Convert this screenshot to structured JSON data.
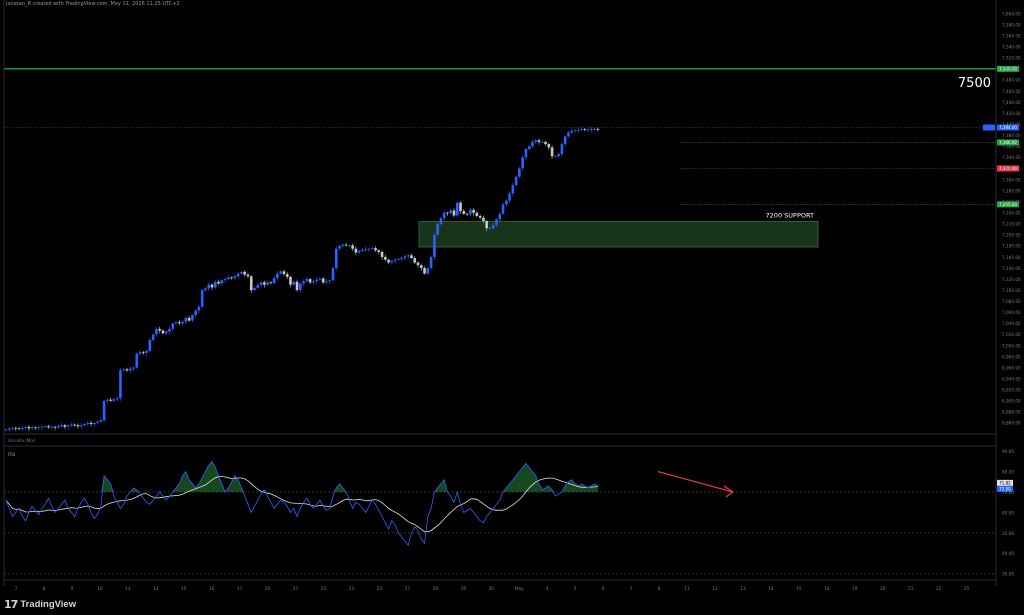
{
  "header": {
    "attribution": "Jonatan_R created with TradingView.com, May 11, 2026 11:25 UTC+2"
  },
  "footer": {
    "brand": "TradingView"
  },
  "colors": {
    "up": "#2962ff",
    "down": "#c7c7c7",
    "resistance": "#26a641",
    "support_fill": "#1b3a1e",
    "support_stroke": "#3f7a3f",
    "rsi_line": "#2962ff",
    "rsi_ma": "#e0e0e0",
    "arrow": "#f23645"
  },
  "chart_data": [
    {
      "type": "candlestick",
      "x_labels": [
        "7",
        "8",
        "9",
        "10",
        "13",
        "14",
        "15",
        "16",
        "17",
        "20",
        "21",
        "22",
        "23",
        "24",
        "27",
        "28",
        "29",
        "30",
        "May",
        "4",
        "5",
        "6",
        "7",
        "8",
        "11",
        "12",
        "13",
        "14",
        "15",
        "18",
        "19",
        "20",
        "21",
        "22",
        "25"
      ],
      "y_ticks": [
        "7,600.00",
        "7,580.00",
        "7,560.00",
        "7,540.00",
        "7,520.00",
        "7,500.00",
        "7,480.00",
        "7,460.00",
        "7,440.00",
        "7,420.00",
        "7,400.00",
        "7,380.00",
        "7,360.00",
        "7,340.00",
        "7,320.00",
        "7,300.00",
        "7,280.00",
        "7,260.00",
        "7,240.00",
        "7,220.00",
        "7,200.00",
        "7,180.00",
        "7,160.00",
        "7,140.00",
        "7,120.00",
        "7,100.00",
        "7,080.00",
        "7,060.00",
        "7,040.00",
        "7,020.00",
        "7,000.00",
        "6,980.00",
        "6,960.00",
        "6,940.00",
        "6,920.00",
        "6,900.00",
        "6,880.00",
        "6,860.00",
        "6,840.00"
      ],
      "ylim": [
        6840,
        7610
      ],
      "closes": [
        6848,
        6850,
        6851,
        6850,
        6849,
        6851,
        6853,
        6850,
        6852,
        6851,
        6852,
        6853,
        6854,
        6852,
        6853,
        6852,
        6854,
        6856,
        6853,
        6855,
        6857,
        6856,
        6854,
        6856,
        6858,
        6860,
        6858,
        6860,
        6862,
        6865,
        6900,
        6902,
        6900,
        6903,
        6905,
        6955,
        6957,
        6955,
        6958,
        6960,
        6985,
        6988,
        6987,
        6990,
        7010,
        7020,
        7030,
        7027,
        7022,
        7025,
        7030,
        7040,
        7042,
        7040,
        7043,
        7050,
        7045,
        7055,
        7063,
        7070,
        7100,
        7103,
        7110,
        7105,
        7115,
        7112,
        7118,
        7120,
        7123,
        7122,
        7125,
        7130,
        7133,
        7128,
        7125,
        7100,
        7104,
        7109,
        7114,
        7110,
        7114,
        7113,
        7122,
        7130,
        7134,
        7129,
        7124,
        7110,
        7115,
        7100,
        7112,
        7116,
        7120,
        7114,
        7116,
        7119,
        7121,
        7114,
        7116,
        7118,
        7140,
        7175,
        7180,
        7182,
        7181,
        7181,
        7175,
        7168,
        7171,
        7173,
        7174,
        7175,
        7176,
        7172,
        7169,
        7160,
        7155,
        7150,
        7153,
        7155,
        7156,
        7158,
        7161,
        7163,
        7158,
        7150,
        7145,
        7140,
        7130,
        7140,
        7160,
        7200,
        7220,
        7230,
        7240,
        7239,
        7244,
        7235,
        7258,
        7243,
        7238,
        7237,
        7245,
        7240,
        7234,
        7231,
        7225,
        7212,
        7212,
        7218,
        7228,
        7238,
        7255,
        7262,
        7275,
        7290,
        7305,
        7320,
        7340,
        7355,
        7360,
        7368,
        7371,
        7368,
        7368,
        7364,
        7358,
        7342,
        7342,
        7346,
        7364,
        7378,
        7385,
        7388,
        7389,
        7390,
        7391,
        7390,
        7390,
        7391,
        7391,
        7390
      ],
      "ohlc_units": "index points",
      "current_price_label": "7,394.00",
      "price_tags": [
        {
          "text": "7,500.00",
          "price": 7500,
          "color": "#26a641"
        },
        {
          "text": "7,394.00",
          "price": 7394,
          "color": "#2962ff"
        },
        {
          "text": "7,366.92",
          "price": 7367,
          "color": "#26a641"
        },
        {
          "text": "7,320.00",
          "price": 7320,
          "color": "#f23645"
        },
        {
          "text": "7,255.00",
          "price": 7255,
          "color": "#26a641"
        }
      ],
      "resistance": {
        "price": 7500,
        "label": "7500"
      },
      "support_zone": {
        "low": 7178,
        "high": 7224,
        "label": "7200 SUPPORT"
      }
    },
    {
      "type": "line",
      "title": "RSI",
      "indicator_label": "Accuma (Mix)",
      "y_ticks": [
        "90.00",
        "80.00",
        "70.00",
        "60.00",
        "50.00",
        "40.00",
        "30.00"
      ],
      "ylim": [
        28,
        92
      ],
      "levels": [
        70,
        50,
        30
      ],
      "rsi": [
        66,
        62,
        58,
        60,
        62,
        58,
        56,
        60,
        63,
        61,
        59,
        62,
        64,
        67,
        63,
        60,
        62,
        64,
        66,
        62,
        60,
        58,
        62,
        65,
        67,
        64,
        60,
        57,
        59,
        63,
        78,
        76,
        74,
        68,
        65,
        62,
        64,
        68,
        70,
        72,
        71,
        69,
        67,
        65,
        64,
        66,
        68,
        70,
        68,
        66,
        68,
        70,
        72,
        74,
        78,
        80,
        76,
        74,
        72,
        74,
        77,
        80,
        83,
        85,
        82,
        78,
        74,
        70,
        72,
        75,
        78,
        76,
        72,
        68,
        64,
        60,
        63,
        66,
        69,
        71,
        68,
        65,
        62,
        64,
        66,
        65,
        63,
        60,
        62,
        58,
        62,
        65,
        67,
        64,
        62,
        64,
        66,
        63,
        61,
        62,
        68,
        72,
        74,
        72,
        70,
        66,
        62,
        65,
        64,
        62,
        60,
        63,
        66,
        64,
        61,
        58,
        55,
        52,
        56,
        54,
        50,
        48,
        46,
        44,
        50,
        53,
        51,
        47,
        45,
        58,
        62,
        70,
        72,
        74,
        76,
        70,
        68,
        65,
        70,
        64,
        60,
        61,
        62,
        60,
        58,
        56,
        55,
        58,
        60,
        62,
        64,
        66,
        70,
        72,
        74,
        76,
        78,
        80,
        82,
        84,
        82,
        80,
        78,
        74,
        71,
        72,
        73,
        71,
        68,
        69,
        70,
        73,
        75,
        76,
        74,
        73,
        74,
        73,
        72,
        73,
        74,
        73
      ],
      "rsi_ma_label": "71.82",
      "rsi_label": "73.00",
      "arrow": "bearish divergence"
    }
  ]
}
